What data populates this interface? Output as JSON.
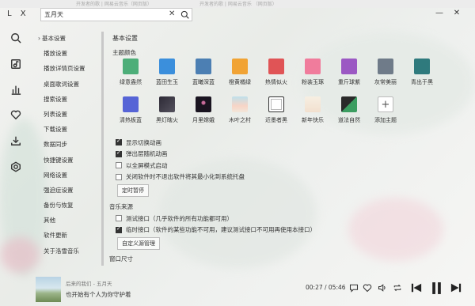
{
  "window": {
    "logo": "L X",
    "background_tabs": [
      "开发者的歌 | 网易云音乐（网页版）",
      "开发者的歌 | 网易云音乐 （网页版）"
    ],
    "close_label": "✕",
    "minimize_label": "—"
  },
  "search": {
    "value": "五月天",
    "clear_label": "✕"
  },
  "rail": [
    "search-icon",
    "playlist-icon",
    "leaderboard-icon",
    "favorite-icon",
    "download-icon",
    "settings-icon"
  ],
  "nav": {
    "items": [
      {
        "label": "基本设置",
        "active": true
      },
      {
        "label": "播放设置"
      },
      {
        "label": "播放详情页设置"
      },
      {
        "label": "桌面歌词设置"
      },
      {
        "label": "搜索设置"
      },
      {
        "label": "列表设置"
      },
      {
        "label": "下载设置"
      },
      {
        "label": "数据同步"
      },
      {
        "label": "快捷键设置"
      },
      {
        "label": "网络设置"
      },
      {
        "label": "强迫症设置"
      },
      {
        "label": "备份与恢复"
      },
      {
        "label": "其他"
      },
      {
        "label": "软件更新"
      },
      {
        "label": "关于洛雪音乐"
      }
    ]
  },
  "basic": {
    "title": "基本设置",
    "theme_color_label": "主题颜色",
    "themes": [
      {
        "label": "绿意盎然",
        "color": "#4dae79"
      },
      {
        "label": "蓝田生玉",
        "color": "#3b8fdc"
      },
      {
        "label": "蓝曦深蓝",
        "color": "#4c7fb3"
      },
      {
        "label": "橙黄橘绿",
        "color": "#f1a334"
      },
      {
        "label": "热情似火",
        "color": "#e05456"
      },
      {
        "label": "粉装玉琢",
        "color": "#f07c9c"
      },
      {
        "label": "重斤球紫",
        "color": "#9b58c3"
      },
      {
        "label": "灰常美丽",
        "color": "#6f7b89"
      },
      {
        "label": "青出于黑",
        "color": "#2f7a7d"
      },
      {
        "label": "清热板蓝",
        "color": "#5664d6"
      },
      {
        "label": "黑灯瞎火",
        "color": "#333333"
      },
      {
        "label": "月里嫦娥",
        "color": "#1d1822"
      },
      {
        "label": "木叶之村",
        "color": "#bfe0ea"
      },
      {
        "label": "近墨者黑",
        "color": "#ffffff"
      },
      {
        "label": "新年快乐",
        "color": "#f4e6d6"
      },
      {
        "label": "道法自然",
        "color": "#3c9d61"
      },
      {
        "label": "添加主题",
        "color": "#ffffff"
      }
    ],
    "options": [
      {
        "label": "显示切换动画",
        "checked": true
      },
      {
        "label": "弹出层随机动画",
        "checked": true
      },
      {
        "label": "以全屏模式启动",
        "checked": false
      },
      {
        "label": "关闭软件时不退出软件将其最小化到系统托盘",
        "checked": false
      }
    ],
    "timer_button": "定时暂停"
  },
  "music_source": {
    "title": "音乐来源",
    "options": [
      {
        "label": "测试接口（几乎软件的所有功能都可用）",
        "checked": false
      },
      {
        "label": "临时接口（软件的某些功能不可用，建议测试接口不可用再使用本接口）",
        "checked": true
      }
    ],
    "custom_button": "自定义源管理"
  },
  "window_size": {
    "title": "窗口尺寸"
  },
  "player": {
    "line1": "后来的我们 - 五月天",
    "line2": "也开始有个人为你守护着",
    "time": "00:27 / 05:46",
    "progress": 0.078,
    "icons": [
      "comment-icon",
      "favorite-icon",
      "volume-icon",
      "repeat-icon",
      "prev-icon",
      "pause-icon",
      "next-icon"
    ]
  }
}
